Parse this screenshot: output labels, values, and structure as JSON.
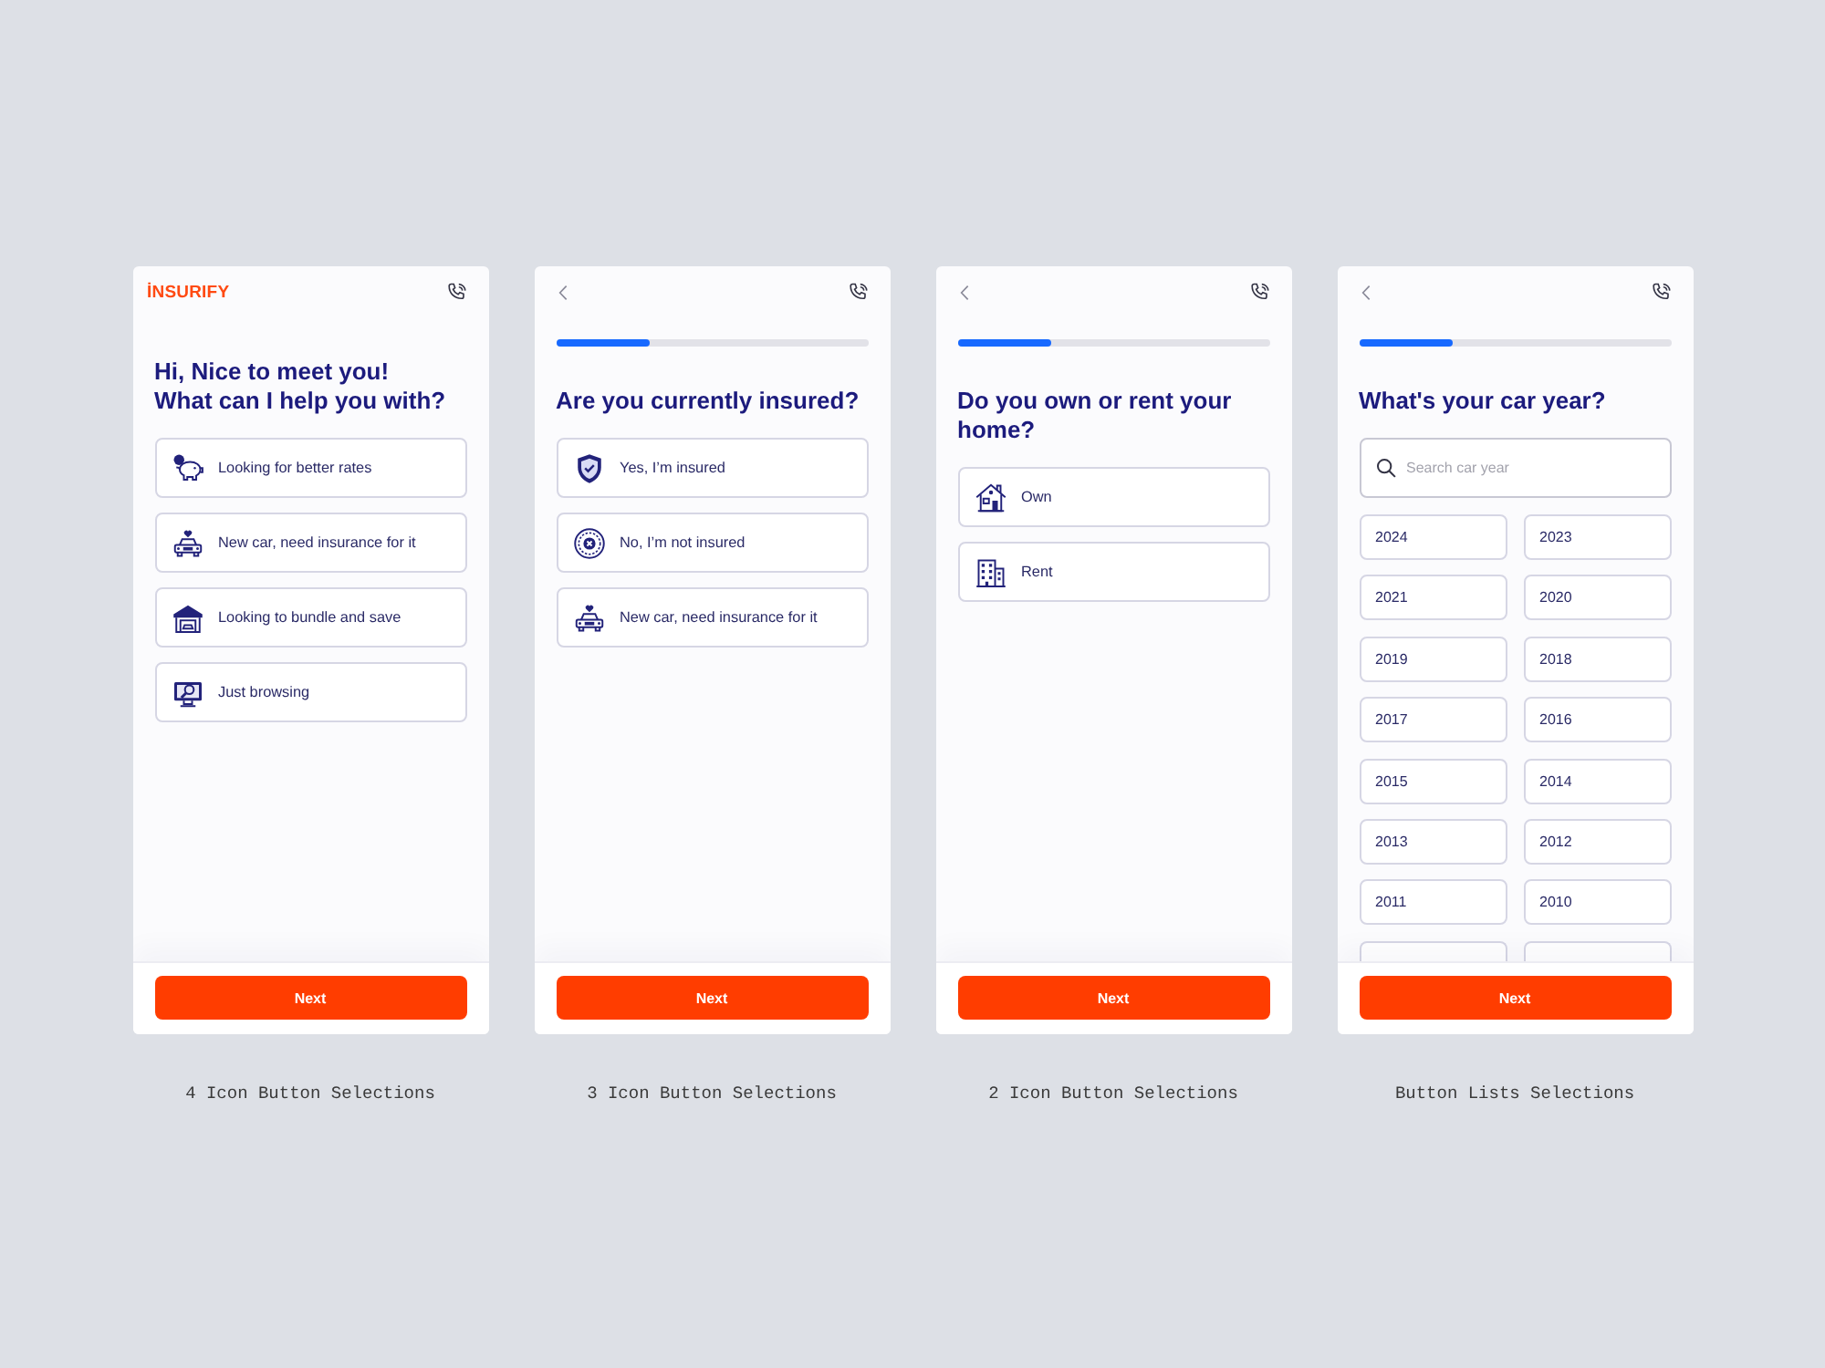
{
  "screens": [
    {
      "header": {
        "logo": "İNSURIFY"
      },
      "title": [
        "Hi, Nice to meet you!",
        "What can I help you with?"
      ],
      "options": [
        {
          "kind": "piggybank",
          "label": "Looking for better rates",
          "selected": false
        },
        {
          "kind": "car",
          "label": "New car, need insurance for it",
          "selected": false
        },
        {
          "kind": "garage",
          "label": "Looking to bundle and save",
          "selected": false
        },
        {
          "kind": "monitor",
          "label": "Just browsing",
          "selected": false
        }
      ],
      "next": "Next",
      "caption": "4 Icon Button Selections"
    },
    {
      "header": {
        "back": true
      },
      "progress": {
        "level": 0.3
      },
      "title": [
        "Are you currently insured?"
      ],
      "options": [
        {
          "kind": "shield",
          "label": "Yes, I’m insured",
          "selected": false
        },
        {
          "kind": "cross",
          "label": "No, I’m not insured",
          "selected": false
        },
        {
          "kind": "car",
          "label": "New car, need insurance for it",
          "selected": false
        }
      ],
      "next": "Next",
      "caption": "3 Icon Button Selections"
    },
    {
      "header": {
        "back": true
      },
      "progress": {
        "level": 0.3
      },
      "title": [
        "Do you own or rent your",
        "home?"
      ],
      "options": [
        {
          "kind": "house",
          "label": "Own",
          "selected": false
        },
        {
          "kind": "building",
          "label": "Rent",
          "selected": false
        }
      ],
      "next": "Next",
      "caption": "2 Icon Button Selections"
    },
    {
      "header": {
        "back": true
      },
      "progress": {
        "level": 0.3
      },
      "title": [
        "What's your car year?"
      ],
      "search": {
        "placeholder": "Search car year"
      },
      "years": {
        "items": [
          {
            "label": "2024",
            "selected": false
          },
          {
            "label": "2023",
            "selected": false
          },
          {
            "label": "2021",
            "selected": false
          },
          {
            "label": "2020",
            "selected": false
          },
          {
            "label": "2019",
            "selected": false
          },
          {
            "label": "2018",
            "selected": false
          },
          {
            "label": "2017",
            "selected": false
          },
          {
            "label": "2016",
            "selected": false
          },
          {
            "label": "2015",
            "selected": false
          },
          {
            "label": "2014",
            "selected": false
          },
          {
            "label": "2013",
            "selected": false
          },
          {
            "label": "2012",
            "selected": false
          },
          {
            "label": "2011",
            "selected": false
          },
          {
            "label": "2010",
            "selected": false
          }
        ],
        "more_below": true
      },
      "next": "Next",
      "caption": "Button Lists Selections"
    }
  ]
}
